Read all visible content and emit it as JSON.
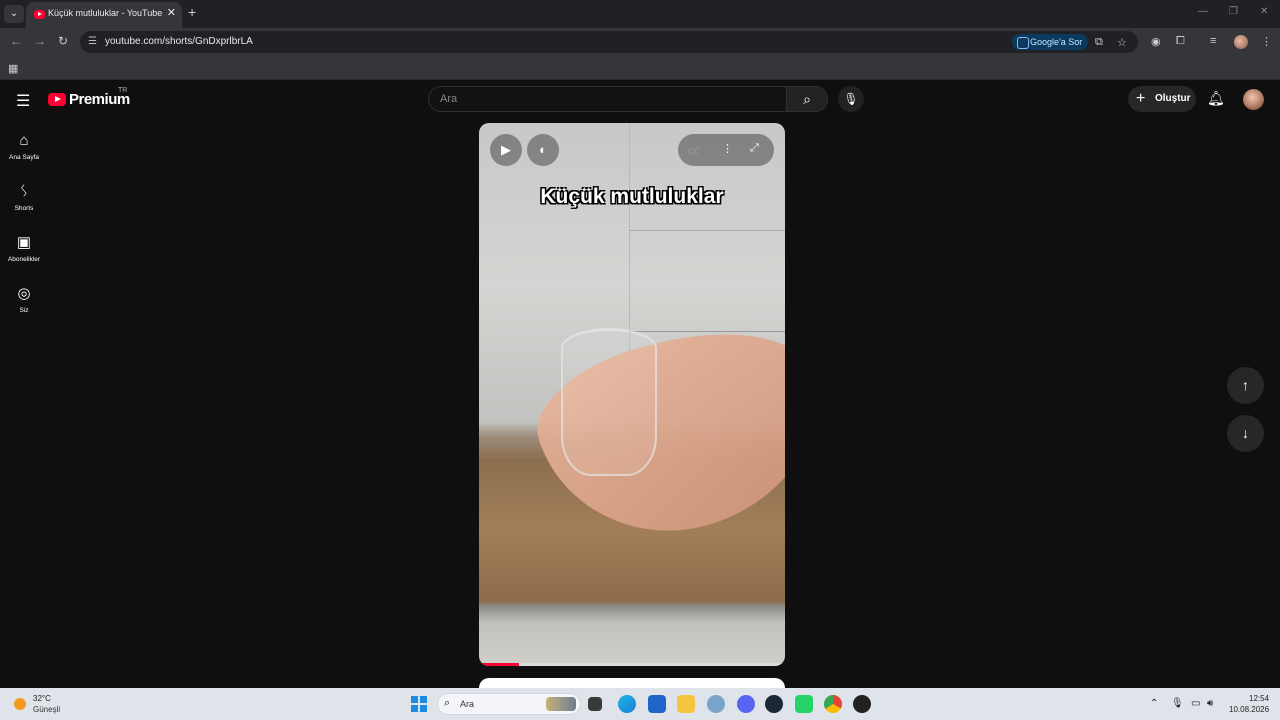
{
  "browser": {
    "tab_title": "Küçük mutluluklar - YouTube",
    "tab_close": "✕",
    "new_tab": "+",
    "url": "youtube.com/shorts/GnDxprlbrLA",
    "google_sor": "Google'a Sor",
    "window_controls": [
      "—",
      "❐",
      "✕"
    ]
  },
  "youtube": {
    "logo_text": "Premium",
    "country_code": "TR",
    "search_placeholder": "Ara",
    "create_label": "Oluştur",
    "sidebar": [
      {
        "label": "Ana Sayfa",
        "icon": "home-icon"
      },
      {
        "label": "Shorts",
        "icon": "shorts-icon"
      },
      {
        "label": "Abonelikler",
        "icon": "subscriptions-icon"
      },
      {
        "label": "Siz",
        "icon": "you-icon"
      }
    ],
    "video": {
      "caption": "Küçük mutluluklar",
      "progress_percent": 13
    }
  },
  "taskbar": {
    "temperature": "32°C",
    "weather": "Güneşli",
    "search_label": "Ara",
    "time": "12:54",
    "date": "10.08.2026"
  },
  "colors": {
    "youtube_red": "#ff0033",
    "background": "#0f0f0f"
  }
}
